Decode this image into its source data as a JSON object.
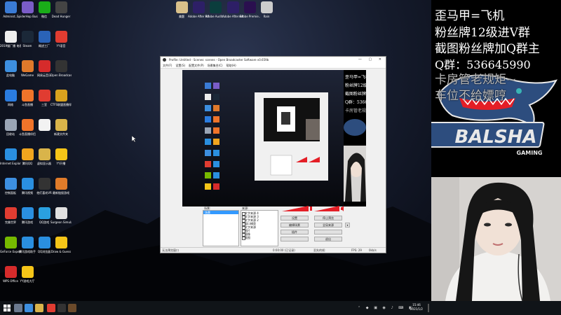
{
  "desktop": {
    "icons_left": [
      {
        "label": "Administ...",
        "color": "#3a7bd5"
      },
      {
        "label": "SpiderHop Business",
        "color": "#7a5cc7"
      },
      {
        "label": "微信",
        "color": "#1aad19"
      },
      {
        "label": "Dead Hunger",
        "color": "#444"
      },
      {
        "label": "2019猫厂播 电视编辑...",
        "color": "#eeeeee"
      },
      {
        "label": "Steam",
        "color": "#1b2838"
      },
      {
        "label": "概述工厂",
        "color": "#2a63b8"
      },
      {
        "label": "YY语音",
        "color": "#e03c31"
      },
      {
        "label": "此电脑",
        "color": "#3d8fe0"
      },
      {
        "label": "WeGame",
        "color": "#e0792b"
      },
      {
        "label": "网易云音乐",
        "color": "#d62b2b"
      },
      {
        "label": "Open Broadcast...",
        "color": "#333"
      },
      {
        "label": "网络",
        "color": "#2a7ce0"
      },
      {
        "label": "斗鱼直播",
        "color": "#f0742a"
      },
      {
        "label": "三室",
        "color": "#e03c31"
      },
      {
        "label": "CTFS联盟直播伴侣",
        "color": "#d9a21e"
      },
      {
        "label": "回收站",
        "color": "#9aa5b5"
      },
      {
        "label": "斗鱼直播伴侣",
        "color": "#f0742a"
      },
      {
        "label": "",
        "color": "#f2f2f2"
      },
      {
        "label": "新建文件夹",
        "color": "#d9b44a"
      },
      {
        "label": "Internet Explorer",
        "color": "#2a8fe0"
      },
      {
        "label": "腾讯QQ",
        "color": "#f0a51e"
      },
      {
        "label": "虚拟显示器",
        "color": "#d9b44a"
      },
      {
        "label": "YY开播",
        "color": "#f5c518"
      },
      {
        "label": "控制面板",
        "color": "#3d8fe0"
      },
      {
        "label": "腾讯视频",
        "color": "#2a8fe0"
      },
      {
        "label": "他们喜欢VR",
        "color": "#333"
      },
      {
        "label": "最新链接游戏",
        "color": "#e07b2a"
      },
      {
        "label": "完美世界",
        "color": "#e03c31"
      },
      {
        "label": "腾讯游戏",
        "color": "#2a8fe0"
      },
      {
        "label": "QQ游戏",
        "color": "#2aa0e0"
      },
      {
        "label": "Surgeon Simulator 2",
        "color": "#e0e0e0"
      },
      {
        "label": "GeForce Experience",
        "color": "#76b900"
      },
      {
        "label": "腾讯游戏助手",
        "color": "#2a8fe0"
      },
      {
        "label": "QQ浏览器",
        "color": "#2a8fe0"
      },
      {
        "label": "Draw & Guess",
        "color": "#f5c518"
      },
      {
        "label": "WPS Office",
        "color": "#d62b2b"
      },
      {
        "label": "YY游戏大厅",
        "color": "#f5c518"
      }
    ],
    "icons_top": [
      {
        "label": "美题",
        "color": "#d9c08a"
      },
      {
        "label": "Adobe After Effects CC ...",
        "color": "#2d1f66"
      },
      {
        "label": "Adobe Audit...",
        "color": "#0b3d3d"
      },
      {
        "label": "Adobe After Effects CC ...",
        "color": "#2d1f66"
      },
      {
        "label": "Adobe Premie...",
        "color": "#2a0f4f"
      },
      {
        "label": "Rain",
        "color": "#cccccc"
      }
    ]
  },
  "obs": {
    "title": "Profile: Untitled - Scenes: scenes - Open Broadcaster Software v0.659b",
    "menu": [
      "文件(F)",
      "设置(S)",
      "配置文件(P)",
      "场景集合(C)",
      "帮助(H)"
    ],
    "scenes_header": "场景:",
    "sources_header": "来源:",
    "scenes": [
      "场景"
    ],
    "sources": [
      "文字来源 4",
      "文字来源 3",
      "文字来源 2",
      "窗口捕获",
      "文字来源",
      "图片",
      "摄像",
      "截图"
    ],
    "buttons": {
      "settings": "设置",
      "stop_preview": "停止预览",
      "edit_scene": "编辑场景",
      "global_sources": "全局来源",
      "plugins": "插件",
      "exit": "退出"
    },
    "status": {
      "left": "无法预览窗口",
      "time": "0:00:00 (已记录)",
      "dropped": "丢失的帧:",
      "fps": "FPS: 29",
      "bitrate": "0kb/s"
    }
  },
  "taskbar": {
    "time": "15:46",
    "date": "2021/1/2",
    "apps": [
      "#6b7a8f",
      "#3d8fe0",
      "#d9b44a",
      "#e03c31",
      "#333333",
      "#6b4a2a",
      "#c22929"
    ]
  },
  "overlay": {
    "lines": [
      "歪马甲=飞机",
      "粉丝牌12级进V群",
      "截图粉丝牌加Q群主",
      "Q群：536645990",
      "卡房管老规矩~",
      "车位不给嫖哼"
    ],
    "logo_text": "BALSHA",
    "logo_sub": "GAMING"
  },
  "colors": {
    "accent_red": "#e41e26",
    "logo_blue": "#2d4d7e",
    "logo_teal": "#3ab4b4"
  }
}
